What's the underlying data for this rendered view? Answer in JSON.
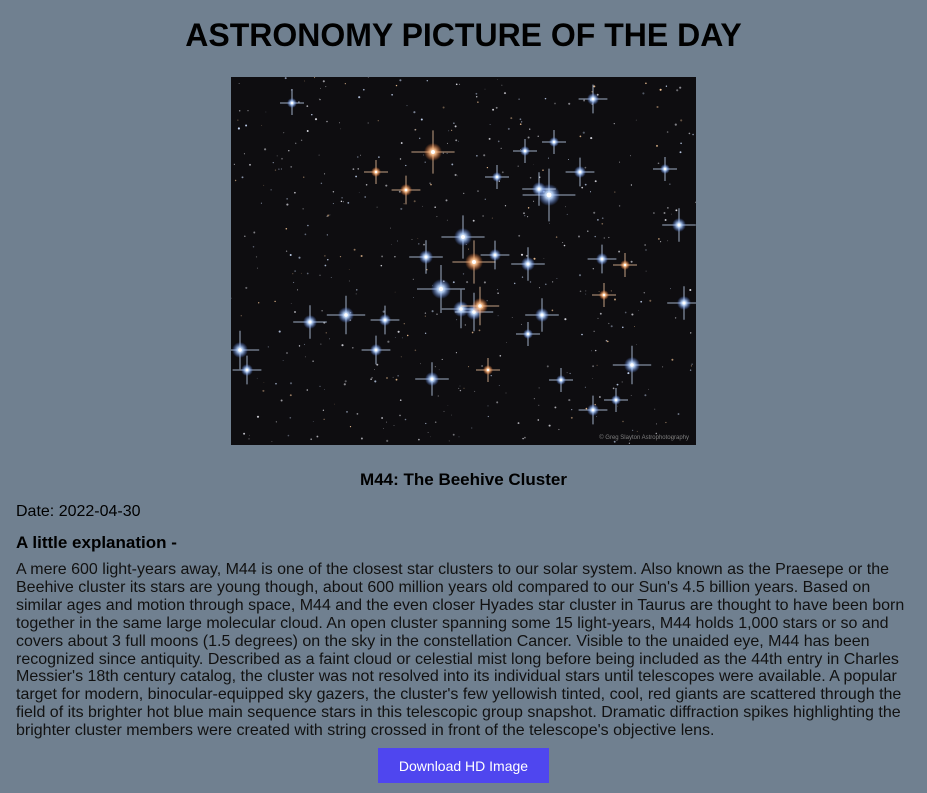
{
  "page": {
    "title": "ASTRONOMY PICTURE OF THE DAY"
  },
  "image": {
    "subject": "open star cluster M44 with blue and orange stars showing diffraction spikes on a dark sky background",
    "credit": "© Greg Slayton Astrophotography"
  },
  "apod": {
    "title": "M44: The Beehive Cluster",
    "date_line": "Date: 2022-04-30",
    "explanation_heading": "A little explanation -",
    "explanation": "A mere 600 light-years away, M44 is one of the closest star clusters to our solar system. Also known as the Praesepe or the Beehive cluster its stars are young though, about 600 million years old compared to our Sun's 4.5 billion years. Based on similar ages and motion through space, M44 and the even closer Hyades star cluster in Taurus are thought to have been born together in the same large molecular cloud. An open cluster spanning some 15 light-years, M44 holds 1,000 stars or so and covers about 3 full moons (1.5 degrees) on the sky in the constellation Cancer. Visible to the unaided eye, M44 has been recognized since antiquity. Described as a faint cloud or celestial mist long before being included as the 44th entry in Charles Messier's 18th century catalog, the cluster was not resolved into its individual stars until telescopes were available. A popular target for modern, binocular-equipped sky gazers, the cluster's few yellowish tinted, cool, red giants are scattered through the field of its brighter hot blue main sequence stars in this telescopic group snapshot. Dramatic diffraction spikes highlighting the brighter cluster members were created with string crossed in front of the telescope's objective lens."
  },
  "actions": {
    "download_label": "Download HD Image"
  },
  "colors": {
    "page_background": "#708090",
    "button_background": "#4f46ef",
    "button_text": "#ffffff",
    "sky": "#0e0d10",
    "blue_star": "#9ec8ff",
    "orange_star": "#ffb070"
  }
}
